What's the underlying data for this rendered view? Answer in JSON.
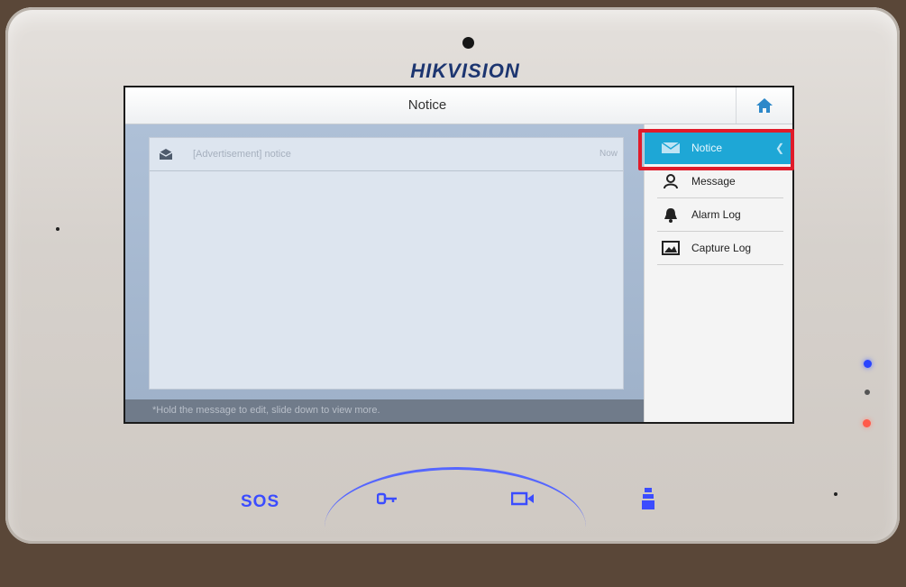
{
  "device": {
    "brand": "HIKVISION",
    "colors": {
      "frame": "#d8d3ce",
      "led_blue": "#2a45ff",
      "led_red": "#ff5a4a"
    }
  },
  "screen": {
    "title": "Notice",
    "home_icon": "home-icon",
    "notices": [
      {
        "icon": "envelope-icon",
        "text": "[Advertisement] notice",
        "time": "Now"
      }
    ],
    "hint": "*Hold the message to edit, slide down to view more."
  },
  "sidebar": {
    "items": [
      {
        "label": "Notice",
        "icon": "mail-icon",
        "selected": true
      },
      {
        "label": "Message",
        "icon": "person-icon"
      },
      {
        "label": "Alarm Log",
        "icon": "bell-icon"
      },
      {
        "label": "Capture Log",
        "icon": "picture-icon"
      }
    ],
    "accent": "#1ea7d6",
    "highlight_color": "#e01b2a"
  },
  "hardware_buttons": {
    "sos_label": "SOS",
    "icons": [
      "key-icon",
      "camera-icon",
      "elevator-icon"
    ]
  }
}
